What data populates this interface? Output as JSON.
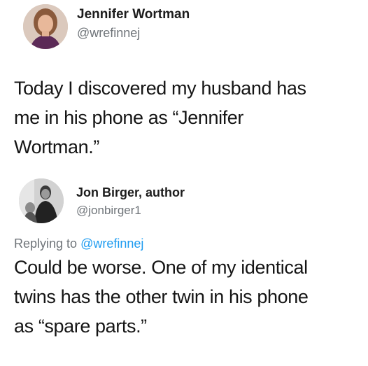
{
  "tweet1": {
    "author_name": "Jennifer Wortman",
    "author_handle": "@wrefinnej",
    "text_lines": [
      "Today I discovered my husband has",
      "me in his phone as “Jennifer",
      "Wortman.”"
    ]
  },
  "tweet2": {
    "author_name": "Jon Birger, author",
    "author_handle": "@jonbirger1",
    "replying_prefix": "Replying to ",
    "replying_mention": "@wrefinnej",
    "text_lines": [
      "Could be worse. One of my identical",
      "twins has the other twin in his phone",
      "as “spare parts.”"
    ]
  },
  "colors": {
    "mention": "#1d9bf0",
    "handle": "#6f7479",
    "text": "#151515"
  },
  "icons": [
    "jennifer-avatar",
    "jon-avatar"
  ]
}
